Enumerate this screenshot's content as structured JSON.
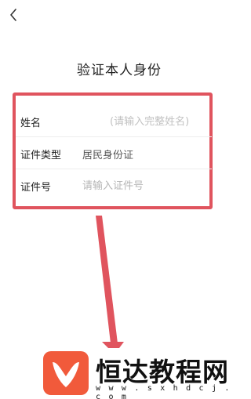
{
  "header": {
    "back_icon": "chevron-left-icon",
    "title": "验证本人身份"
  },
  "form": {
    "rows": [
      {
        "label": "姓名",
        "placeholder": "(请输入完整姓名)"
      },
      {
        "label": "证件类型",
        "value": "居民身份证"
      },
      {
        "label": "证件号",
        "placeholder": "请输入证件号"
      }
    ]
  },
  "annotation": {
    "highlight_color": "#e0545e",
    "arrow_color": "#e0545e"
  },
  "watermark": {
    "name": "恒达教程网",
    "url": "w w w . s x h d c j . c o m",
    "logo_color": "#f15a3b"
  }
}
